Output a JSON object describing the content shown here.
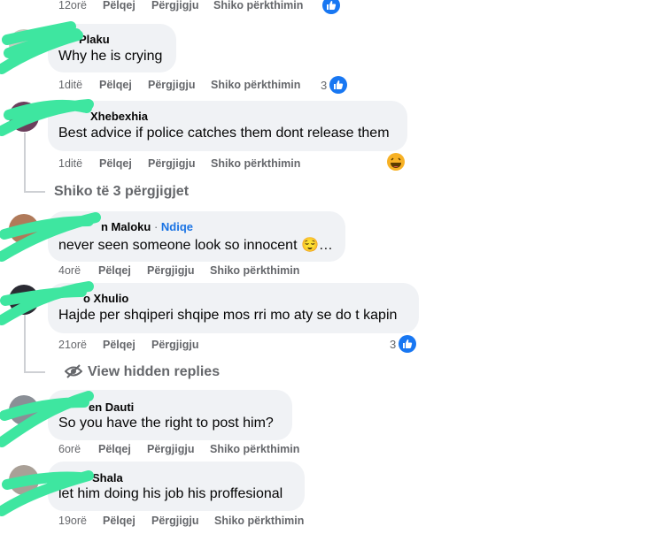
{
  "actions": {
    "like": "Pëlqej",
    "reply": "Përgjigju",
    "translate": "Shiko përkthimin"
  },
  "top": {
    "time": "12orë"
  },
  "comments": [
    {
      "name": "Plaku",
      "text": "Why he is crying",
      "time": "1ditë",
      "likes": "3"
    },
    {
      "name": "Xhebexhia",
      "text": "Best advice if police catches them dont release them",
      "time": "1ditë"
    },
    {
      "name": "n Maloku",
      "follow": "Ndiqe",
      "text": "never seen someone look so innocent",
      "time": "4orë"
    },
    {
      "name": "o Xhulio",
      "text": "Hajde per shqiperi shqipe mos rri mo aty se do t kapin",
      "time": "21orë",
      "likes": "3"
    },
    {
      "name": "en Dauti",
      "text": "So you have the right to post him?",
      "time": "6orë"
    },
    {
      "name": "Shala",
      "text": "let him doing his job his proffesional",
      "time": "19orë"
    }
  ],
  "view_replies": "Shiko të 3 përgjigjet",
  "hidden_replies": "View hidden replies",
  "colors": {
    "accent": "#1877f2",
    "bubble": "#f0f2f5",
    "meta": "#65676b",
    "scribble": "#3ee6a0"
  }
}
